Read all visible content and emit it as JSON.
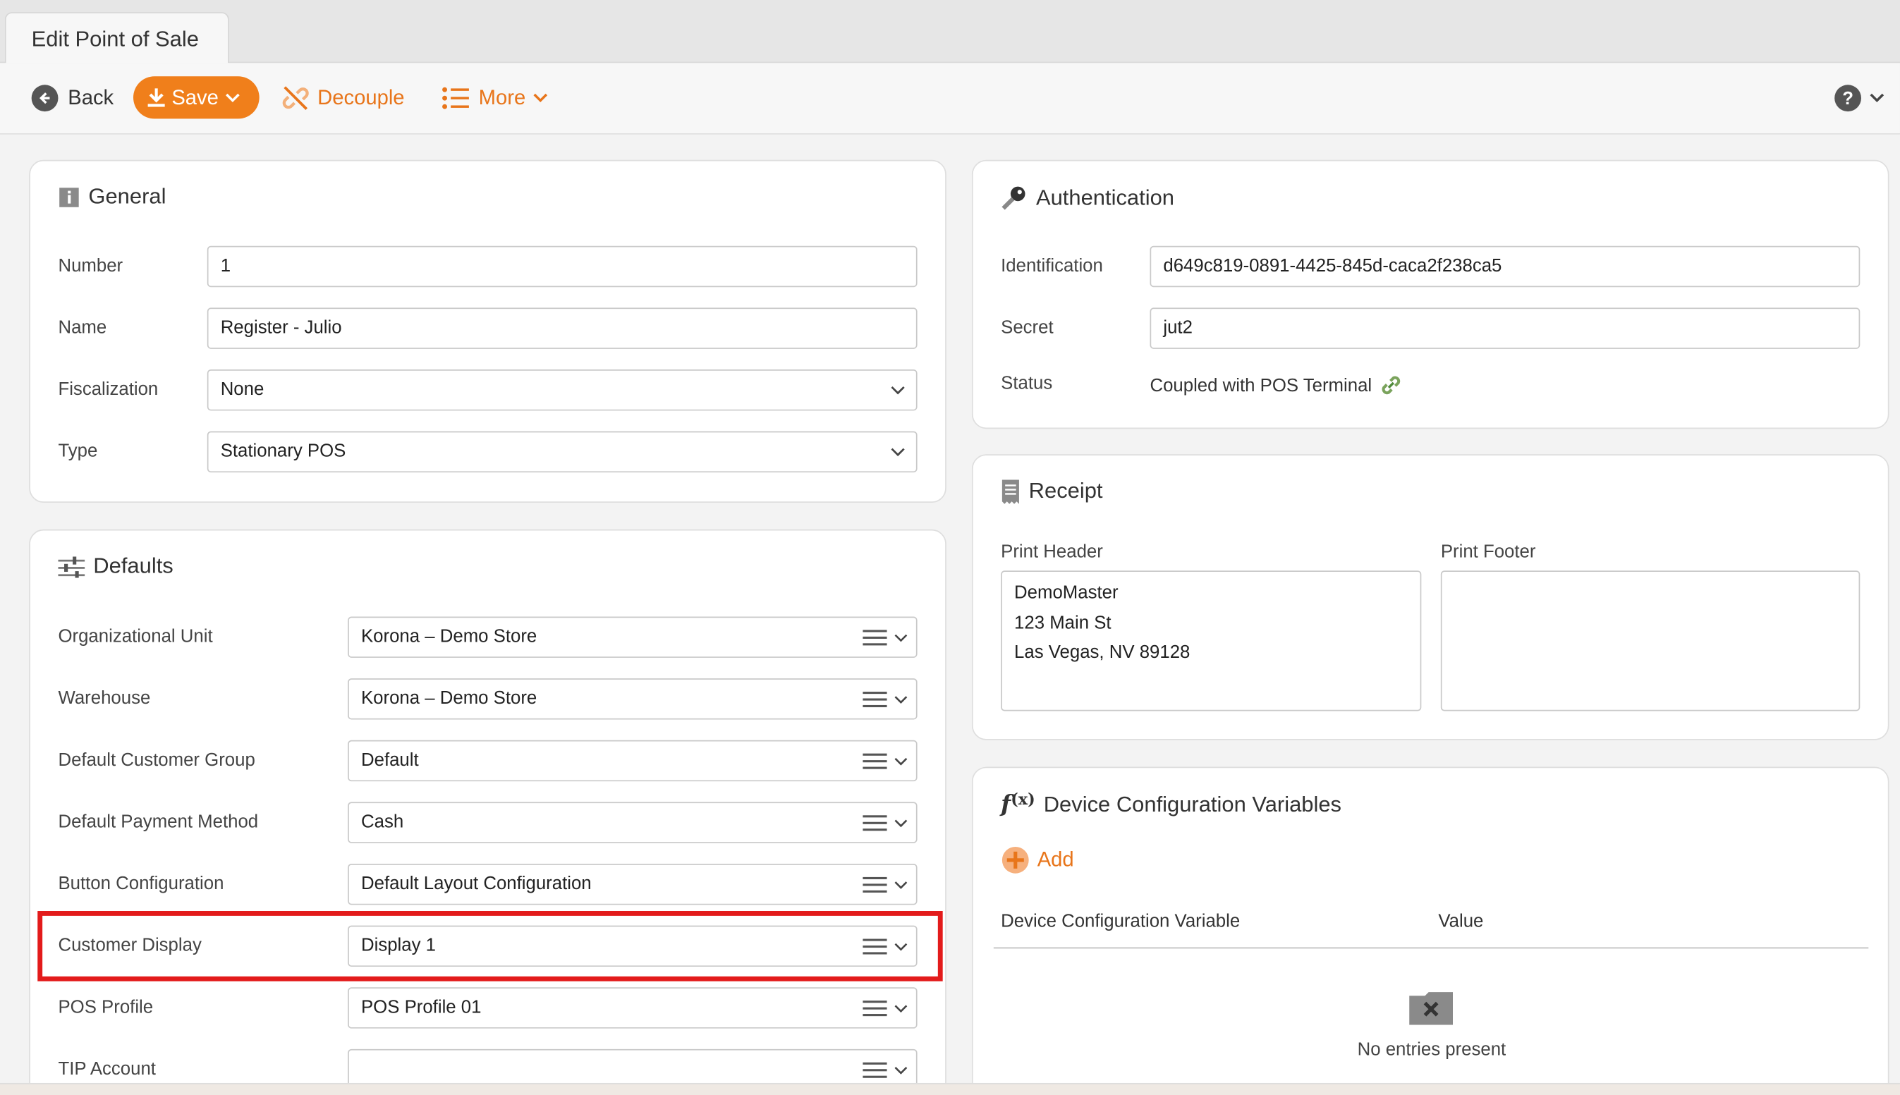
{
  "tab": {
    "title": "Edit Point of Sale"
  },
  "toolbar": {
    "back": "Back",
    "save": "Save",
    "decouple": "Decouple",
    "more": "More"
  },
  "colors": {
    "accent": "#f07f1b",
    "highlight": "#e31b1b"
  },
  "general": {
    "title": "General",
    "number_label": "Number",
    "number_value": "1",
    "name_label": "Name",
    "name_value": "Register - Julio",
    "fiscalization_label": "Fiscalization",
    "fiscalization_value": "None",
    "type_label": "Type",
    "type_value": "Stationary POS"
  },
  "defaults": {
    "title": "Defaults",
    "rows": [
      {
        "label": "Organizational Unit",
        "value": "Korona – Demo Store"
      },
      {
        "label": "Warehouse",
        "value": "Korona – Demo Store"
      },
      {
        "label": "Default Customer Group",
        "value": "Default"
      },
      {
        "label": "Default Payment Method",
        "value": "Cash"
      },
      {
        "label": "Button Configuration",
        "value": "Default Layout Configuration"
      },
      {
        "label": "Customer Display",
        "value": "Display 1"
      },
      {
        "label": "POS Profile",
        "value": "POS Profile 01"
      },
      {
        "label": "TIP Account",
        "value": ""
      }
    ]
  },
  "auth": {
    "title": "Authentication",
    "identification_label": "Identification",
    "identification_value": "d649c819-0891-4425-845d-caca2f238ca5",
    "secret_label": "Secret",
    "secret_value": "jut2",
    "status_label": "Status",
    "status_value": "Coupled with POS Terminal"
  },
  "receipt": {
    "title": "Receipt",
    "header_label": "Print Header",
    "header_value": "DemoMaster\n123 Main St\nLas Vegas, NV 89128",
    "footer_label": "Print Footer",
    "footer_value": ""
  },
  "dcv": {
    "title": "Device Configuration Variables",
    "add": "Add",
    "col_variable": "Device Configuration Variable",
    "col_value": "Value",
    "empty": "No entries present"
  }
}
